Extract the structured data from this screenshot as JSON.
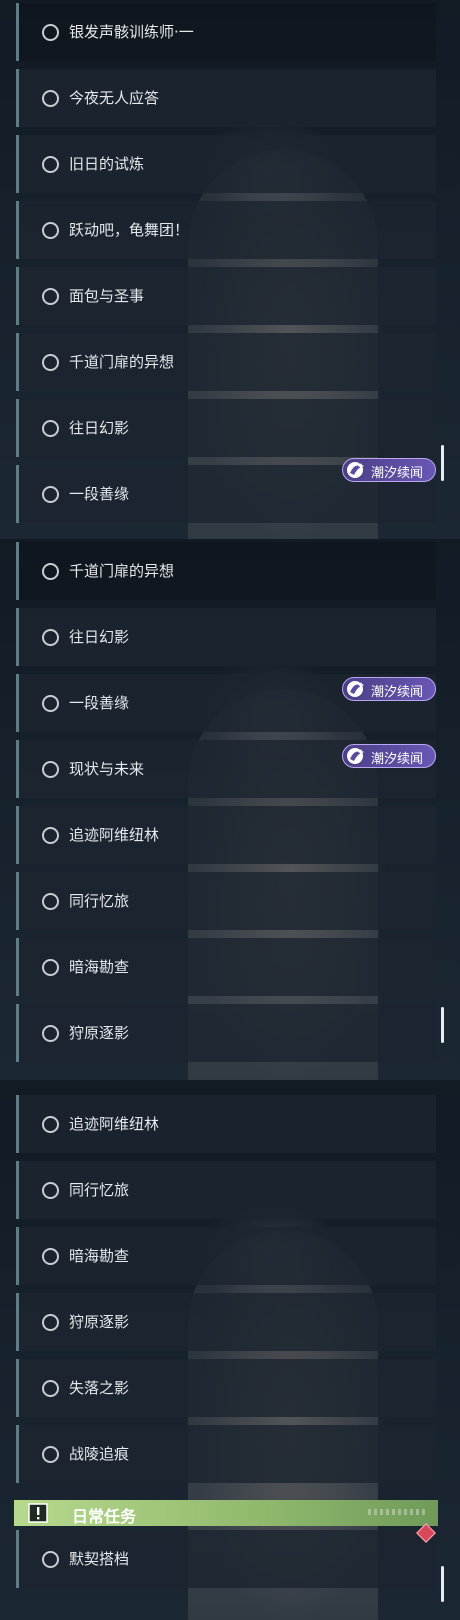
{
  "panels": [
    {
      "rows": [
        {
          "label": "银发声骸训练师·一"
        },
        {
          "label": "今夜无人应答"
        },
        {
          "label": "旧日的试炼"
        },
        {
          "label": "跃动吧，龟舞团！"
        },
        {
          "label": "面包与圣事"
        },
        {
          "label": "千道门扉的异想"
        },
        {
          "label": "往日幻影"
        },
        {
          "label": "一段善缘"
        }
      ],
      "badges": [
        {
          "text": "潮汐续闻"
        }
      ]
    },
    {
      "rows": [
        {
          "label": "千道门扉的异想"
        },
        {
          "label": "往日幻影"
        },
        {
          "label": "一段善缘"
        },
        {
          "label": "现状与未来"
        },
        {
          "label": "追迹阿维纽林"
        },
        {
          "label": "同行忆旅"
        },
        {
          "label": "暗海勘查"
        },
        {
          "label": "狩原逐影"
        }
      ],
      "badges": [
        {
          "text": "潮汐续闻"
        },
        {
          "text": "潮汐续闻"
        }
      ]
    },
    {
      "rows": [
        {
          "label": "追迹阿维纽林"
        },
        {
          "label": "同行忆旅"
        },
        {
          "label": "暗海勘查"
        },
        {
          "label": "狩原逐影"
        },
        {
          "label": "失落之影"
        },
        {
          "label": "战陵追痕"
        }
      ],
      "section": {
        "title": "日常任务",
        "icon": "exclamation-icon"
      },
      "daily_rows": [
        {
          "label": "默契搭档"
        }
      ]
    }
  ],
  "colors": {
    "accent_green": "#a8cf7f",
    "badge_purple": "#5a4aa0",
    "row_bar": "#5f7d86",
    "alert_red": "#d9475b"
  }
}
